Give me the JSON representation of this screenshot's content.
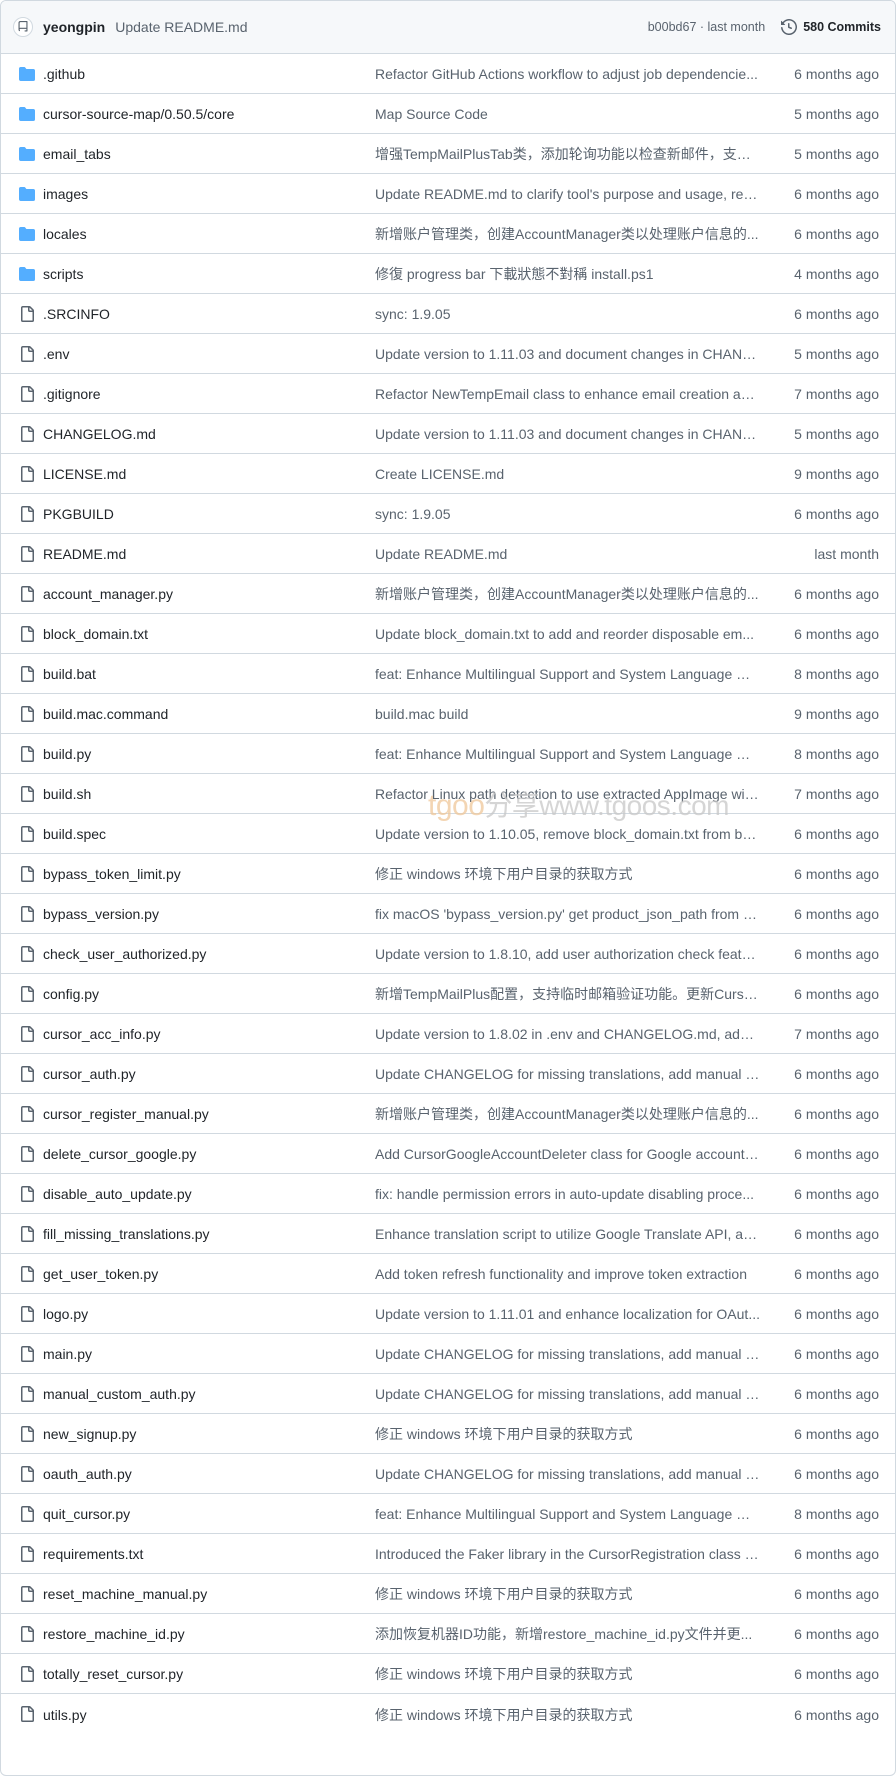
{
  "header": {
    "author": "yeongpin",
    "commit_message": "Update README.md",
    "commit_meta": "b00bd67 · last month",
    "commits_label": "580 Commits"
  },
  "icons": {
    "dir": "folder-icon",
    "file": "file-icon",
    "history": "history-icon"
  },
  "colors": {
    "folder": "#54aeff",
    "link": "#1f2328",
    "muted": "#59636e",
    "border": "#d1d9e0",
    "header_bg": "#f6f8fa"
  },
  "watermark": {
    "part1": "tgoo",
    "part2": "分享",
    "part3": "www.tgoos.com"
  },
  "files": [
    {
      "type": "dir",
      "name": ".github",
      "message": "Refactor GitHub Actions workflow to adjust job dependencie...",
      "age": "6 months ago"
    },
    {
      "type": "dir",
      "name": "cursor-source-map/0.50.5/core",
      "message": "Map Source Code",
      "age": "5 months ago"
    },
    {
      "type": "dir",
      "name": "email_tabs",
      "message": "增强TempMailPlusTab类，添加轮询功能以检查新邮件，支持...",
      "age": "5 months ago"
    },
    {
      "type": "dir",
      "name": "images",
      "message": "Update README.md to clarify tool's purpose and usage, rem...",
      "age": "6 months ago"
    },
    {
      "type": "dir",
      "name": "locales",
      "message": "新增账户管理类，创建AccountManager类以处理账户信息的...",
      "age": "6 months ago"
    },
    {
      "type": "dir",
      "name": "scripts",
      "message": "修復 progress bar 下載狀態不對稱 install.ps1",
      "age": "4 months ago"
    },
    {
      "type": "file",
      "name": ".SRCINFO",
      "message": "sync: 1.9.05",
      "age": "6 months ago"
    },
    {
      "type": "file",
      "name": ".env",
      "message": "Update version to 1.11.03 and document changes in CHANG...",
      "age": "5 months ago"
    },
    {
      "type": "file",
      "name": ".gitignore",
      "message": "Refactor NewTempEmail class to enhance email creation and...",
      "age": "7 months ago"
    },
    {
      "type": "file",
      "name": "CHANGELOG.md",
      "message": "Update version to 1.11.03 and document changes in CHANG...",
      "age": "5 months ago"
    },
    {
      "type": "file",
      "name": "LICENSE.md",
      "message": "Create LICENSE.md",
      "age": "9 months ago"
    },
    {
      "type": "file",
      "name": "PKGBUILD",
      "message": "sync: 1.9.05",
      "age": "6 months ago"
    },
    {
      "type": "file",
      "name": "README.md",
      "message": "Update README.md",
      "age": "last month"
    },
    {
      "type": "file",
      "name": "account_manager.py",
      "message": "新增账户管理类，创建AccountManager类以处理账户信息的...",
      "age": "6 months ago"
    },
    {
      "type": "file",
      "name": "block_domain.txt",
      "message": "Update block_domain.txt to add and reorder disposable em...",
      "age": "6 months ago"
    },
    {
      "type": "file",
      "name": "build.bat",
      "message": "feat: Enhance Multilingual Support and System Language De...",
      "age": "8 months ago"
    },
    {
      "type": "file",
      "name": "build.mac.command",
      "message": "build.mac build",
      "age": "9 months ago"
    },
    {
      "type": "file",
      "name": "build.py",
      "message": "feat: Enhance Multilingual Support and System Language De...",
      "age": "8 months ago"
    },
    {
      "type": "file",
      "name": "build.sh",
      "message": "Refactor Linux path detection to use extracted AppImage wit...",
      "age": "7 months ago"
    },
    {
      "type": "file",
      "name": "build.spec",
      "message": "Update version to 1.10.05, remove block_domain.txt from bu...",
      "age": "6 months ago"
    },
    {
      "type": "file",
      "name": "bypass_token_limit.py",
      "message": "修正 windows 环境下用户目录的获取方式",
      "age": "6 months ago"
    },
    {
      "type": "file",
      "name": "bypass_version.py",
      "message": "fix macOS 'bypass_version.py' get product_json_path from c...",
      "age": "6 months ago"
    },
    {
      "type": "file",
      "name": "check_user_authorized.py",
      "message": "Update version to 1.8.10, add user authorization check featu...",
      "age": "6 months ago"
    },
    {
      "type": "file",
      "name": "config.py",
      "message": "新增TempMailPlus配置，支持临时邮箱验证功能。更新Curso...",
      "age": "6 months ago"
    },
    {
      "type": "file",
      "name": "cursor_acc_info.py",
      "message": "Update version to 1.8.02 in .env and CHANGELOG.md, addin...",
      "age": "7 months ago"
    },
    {
      "type": "file",
      "name": "cursor_auth.py",
      "message": "Update CHANGELOG for missing translations, add manual c...",
      "age": "6 months ago"
    },
    {
      "type": "file",
      "name": "cursor_register_manual.py",
      "message": "新增账户管理类，创建AccountManager类以处理账户信息的...",
      "age": "6 months ago"
    },
    {
      "type": "file",
      "name": "delete_cursor_google.py",
      "message": "Add CursorGoogleAccountDeleter class for Google account ...",
      "age": "6 months ago"
    },
    {
      "type": "file",
      "name": "disable_auto_update.py",
      "message": "fix: handle permission errors in auto-update disabling proce...",
      "age": "6 months ago"
    },
    {
      "type": "file",
      "name": "fill_missing_translations.py",
      "message": "Enhance translation script to utilize Google Translate API, ad...",
      "age": "6 months ago"
    },
    {
      "type": "file",
      "name": "get_user_token.py",
      "message": "Add token refresh functionality and improve token extraction",
      "age": "6 months ago"
    },
    {
      "type": "file",
      "name": "logo.py",
      "message": "Update version to 1.11.01 and enhance localization for OAut...",
      "age": "6 months ago"
    },
    {
      "type": "file",
      "name": "main.py",
      "message": "Update CHANGELOG for missing translations, add manual c...",
      "age": "6 months ago"
    },
    {
      "type": "file",
      "name": "manual_custom_auth.py",
      "message": "Update CHANGELOG for missing translations, add manual c...",
      "age": "6 months ago"
    },
    {
      "type": "file",
      "name": "new_signup.py",
      "message": "修正 windows 环境下用户目录的获取方式",
      "age": "6 months ago"
    },
    {
      "type": "file",
      "name": "oauth_auth.py",
      "message": "Update CHANGELOG for missing translations, add manual c...",
      "age": "6 months ago"
    },
    {
      "type": "file",
      "name": "quit_cursor.py",
      "message": "feat: Enhance Multilingual Support and System Language De...",
      "age": "8 months ago"
    },
    {
      "type": "file",
      "name": "requirements.txt",
      "message": "Introduced the Faker library in the CursorRegistration class t...",
      "age": "6 months ago"
    },
    {
      "type": "file",
      "name": "reset_machine_manual.py",
      "message": "修正 windows 环境下用户目录的获取方式",
      "age": "6 months ago"
    },
    {
      "type": "file",
      "name": "restore_machine_id.py",
      "message": "添加恢复机器ID功能，新增restore_machine_id.py文件并更...",
      "age": "6 months ago"
    },
    {
      "type": "file",
      "name": "totally_reset_cursor.py",
      "message": "修正 windows 环境下用户目录的获取方式",
      "age": "6 months ago"
    },
    {
      "type": "file",
      "name": "utils.py",
      "message": "修正 windows 环境下用户目录的获取方式",
      "age": "6 months ago"
    }
  ]
}
